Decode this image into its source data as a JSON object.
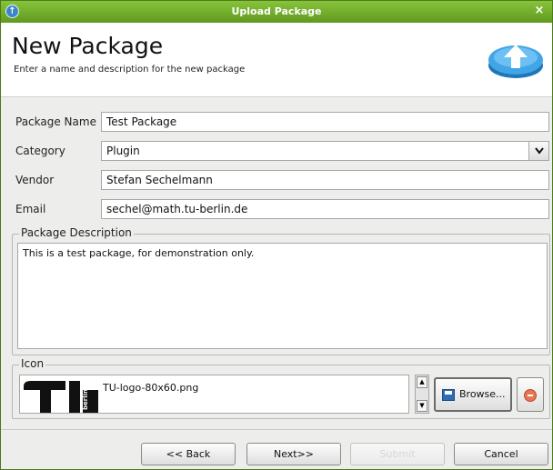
{
  "window": {
    "title": "Upload Package",
    "close_glyph": "×",
    "app_glyph": "↑"
  },
  "header": {
    "title": "New Package",
    "subtitle": "Enter a name and description for the new package",
    "icon": "upload-arrow-icon"
  },
  "form": {
    "package_name_label": "Package Name",
    "package_name_value": "Test Package",
    "category_label": "Category",
    "category_value": "Plugin",
    "vendor_label": "Vendor",
    "vendor_value": "Stefan Sechelmann",
    "email_label": "Email",
    "email_value": "sechel@math.tu-berlin.de"
  },
  "description": {
    "group_title": "Package Description",
    "text": "This is a test package, for demonstration only."
  },
  "icon_group": {
    "group_title": "Icon",
    "file_name": "TU-logo-80x60.png",
    "logo_text": "berlin",
    "browse_label": "Browse..."
  },
  "footer": {
    "back_label": "<< Back",
    "next_label": "Next>>",
    "submit_label": "Submit",
    "cancel_label": "Cancel"
  },
  "colors": {
    "titlebar": "#6fae2a",
    "accent": "#3b86c9"
  }
}
